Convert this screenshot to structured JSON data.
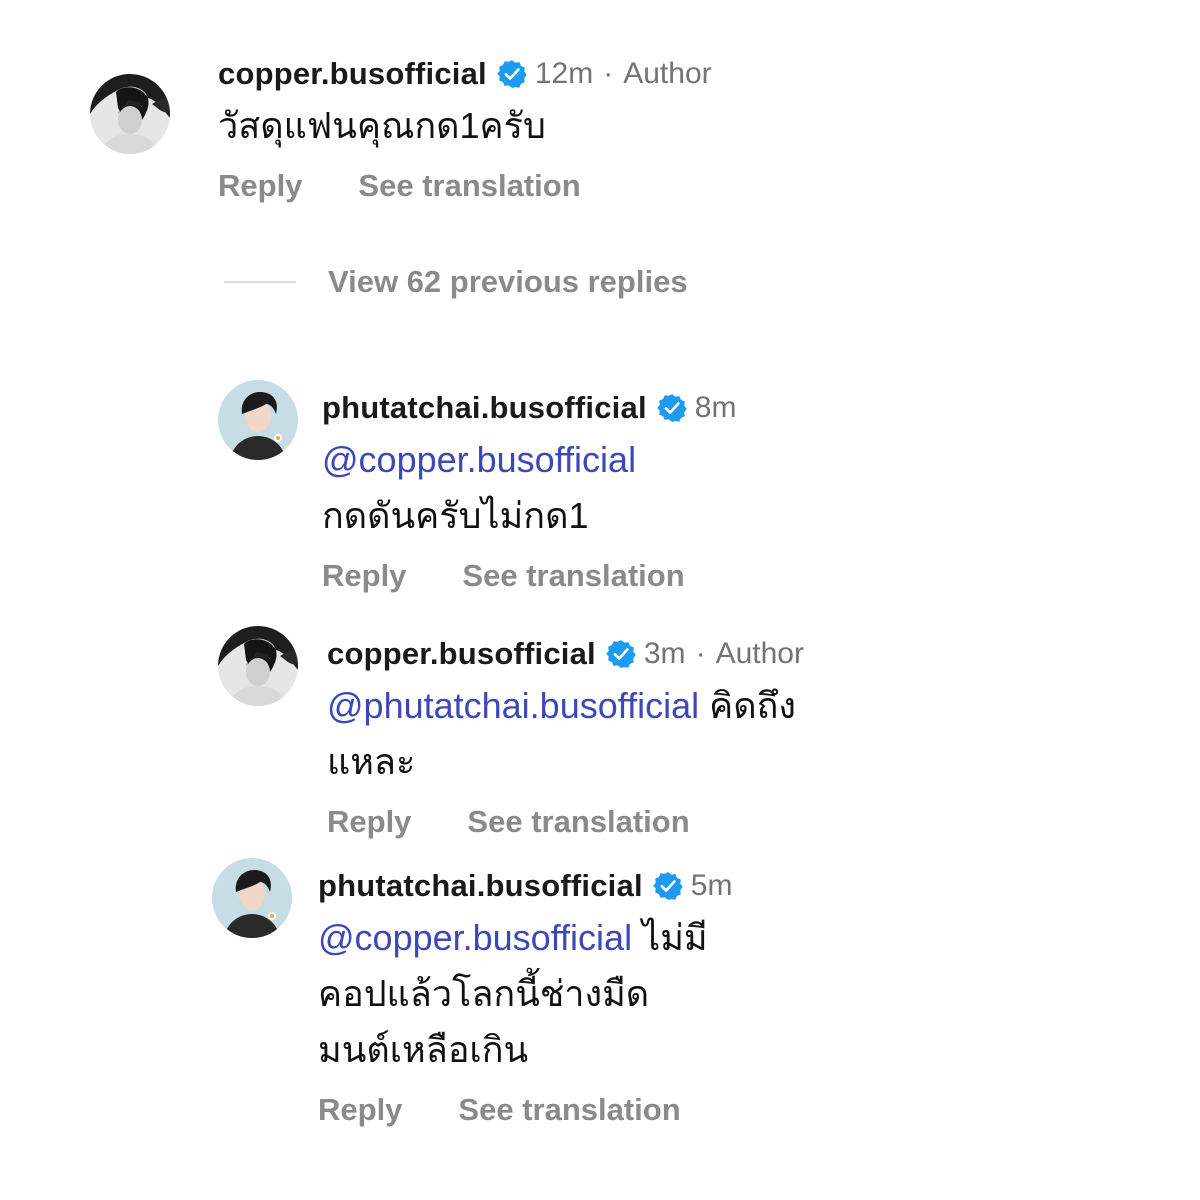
{
  "colors": {
    "mention": "#3c48b8",
    "verified": "#1d9bf0",
    "muted": "#8a8a8a"
  },
  "comments": [
    {
      "username": "copper.busofficial",
      "time": "12m",
      "separator": "·",
      "author_label": "Author",
      "mention": "",
      "text": "วัสดุแฟนคุณกด1ครับ",
      "reply_label": "Reply",
      "translate_label": "See translation",
      "avatar": "avatar-dark-bw"
    },
    {
      "username": "phutatchai.busofficial",
      "time": "8m",
      "mention": "@copper.busofficial",
      "text": "กดดันครับไม่กด1",
      "reply_label": "Reply",
      "translate_label": "See translation",
      "avatar": "avatar-blue-bg"
    },
    {
      "username": "copper.busofficial",
      "time": "3m",
      "separator": "·",
      "author_label": "Author",
      "mention": "@phutatchai.busofficial",
      "text": "คิดถึงแหละ",
      "reply_label": "Reply",
      "translate_label": "See translation",
      "avatar": "avatar-dark-bw"
    },
    {
      "username": "phutatchai.busofficial",
      "time": "5m",
      "mention": "@copper.busofficial",
      "text": "ไม่มีคอปแล้วโลกนี้ช่างมืด",
      "text_line2": "มนต์เหลือเกิน",
      "reply_label": "Reply",
      "translate_label": "See translation",
      "avatar": "avatar-blue-bg"
    }
  ],
  "view_previous": "View 62 previous replies"
}
